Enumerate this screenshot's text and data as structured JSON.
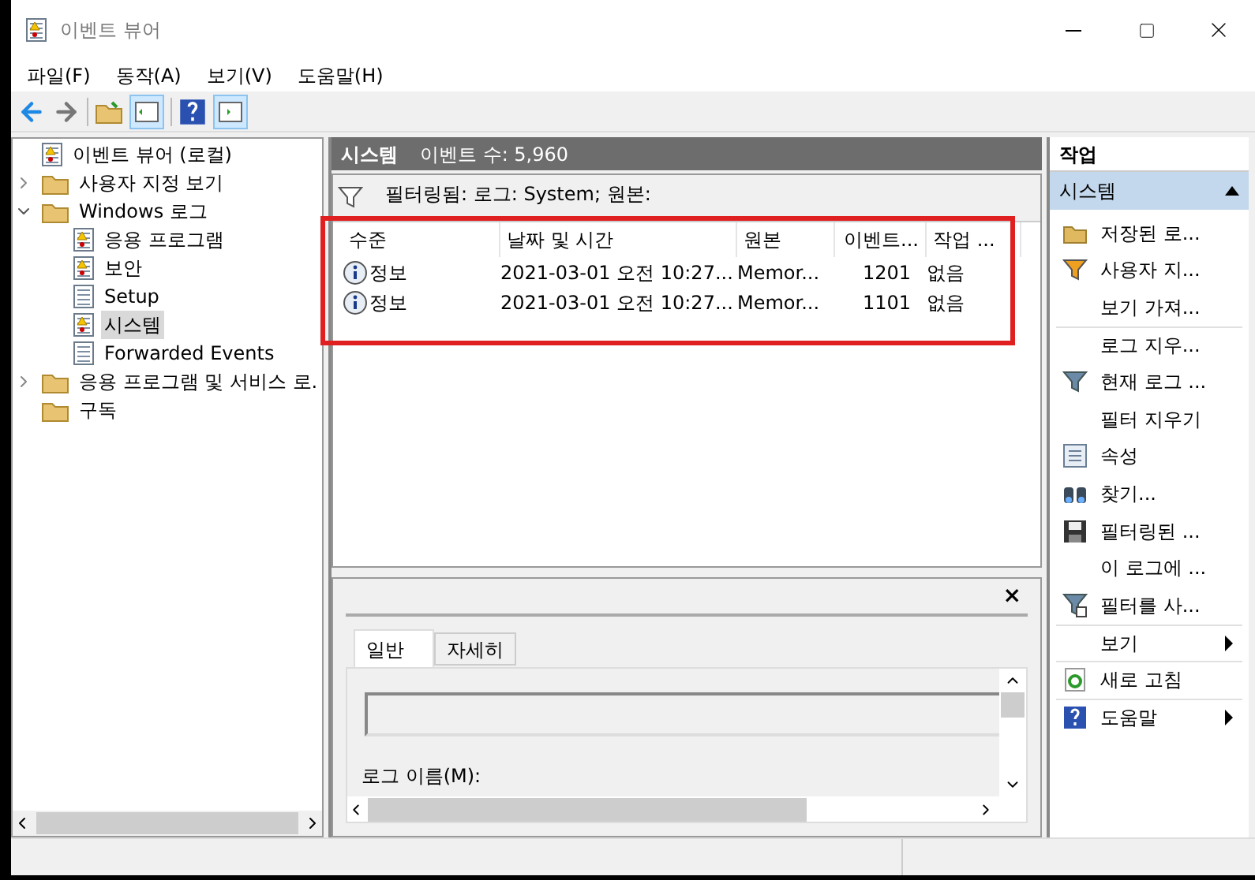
{
  "window": {
    "title": "이벤트 뷰어"
  },
  "menu": [
    "파일(F)",
    "동작(A)",
    "보기(V)",
    "도움말(H)"
  ],
  "tree": [
    {
      "label": "이벤트 뷰어 (로컬)",
      "selected": false,
      "children": [
        {
          "label": "사용자 지정 보기",
          "selected": false,
          "expanded": false
        },
        {
          "label": "Windows 로그",
          "selected": false,
          "expanded": true,
          "children": [
            {
              "label": "응용 프로그램",
              "selected": false
            },
            {
              "label": "보안",
              "selected": false
            },
            {
              "label": "Setup",
              "selected": false
            },
            {
              "label": "시스템",
              "selected": true
            },
            {
              "label": "Forwarded Events",
              "selected": false
            }
          ]
        },
        {
          "label": "응용 프로그램 및 서비스 로.",
          "selected": false,
          "expanded": false
        },
        {
          "label": "구독",
          "selected": false
        }
      ]
    }
  ],
  "log_header": {
    "name": "시스템",
    "count": "이벤트 수: 5,960"
  },
  "filter_text": "필터링됨: 로그: System; 원본:",
  "events_table": {
    "highlighted": true,
    "columns": [
      "수준",
      "날짜 및 시간",
      "원본",
      "이벤트...",
      "작업 ..."
    ],
    "rows": [
      [
        "정보",
        "2021-03-01 오전 10:27...",
        "Memor...",
        "1201",
        "없음"
      ],
      [
        "정보",
        "2021-03-01 오전 10:27...",
        "Memor...",
        "1101",
        "없음"
      ]
    ]
  },
  "preview": {
    "close": "×",
    "tabs": [
      {
        "label": "일반",
        "selected": true
      },
      {
        "label": "자세히",
        "selected": false
      }
    ],
    "log_name_label": "로그 이름(M):"
  },
  "actions": {
    "title": "작업",
    "section": {
      "label": "시스템",
      "expanded": true
    },
    "items": [
      {
        "label": "저장된 로...",
        "kind": "item",
        "separator_before": false
      },
      {
        "label": "사용자 지...",
        "kind": "item",
        "separator_before": false
      },
      {
        "label": "보기 가져...",
        "kind": "item",
        "separator_before": false
      },
      {
        "label": "로그 지우...",
        "kind": "item",
        "separator_before": true
      },
      {
        "label": "현재 로그 ...",
        "kind": "item",
        "separator_before": false
      },
      {
        "label": "필터 지우기",
        "kind": "item",
        "separator_before": false
      },
      {
        "label": "속성",
        "kind": "item",
        "separator_before": false
      },
      {
        "label": "찾기...",
        "kind": "item",
        "separator_before": false
      },
      {
        "label": "필터링된 ...",
        "kind": "item",
        "separator_before": false
      },
      {
        "label": "이 로그에 ...",
        "kind": "item",
        "separator_before": false
      },
      {
        "label": "필터를 사...",
        "kind": "item",
        "separator_before": false
      },
      {
        "label": "보기",
        "kind": "submenu",
        "separator_before": true
      },
      {
        "label": "새로 고침",
        "kind": "item",
        "separator_before": true
      },
      {
        "label": "도움말",
        "kind": "submenu",
        "separator_before": true
      }
    ]
  }
}
